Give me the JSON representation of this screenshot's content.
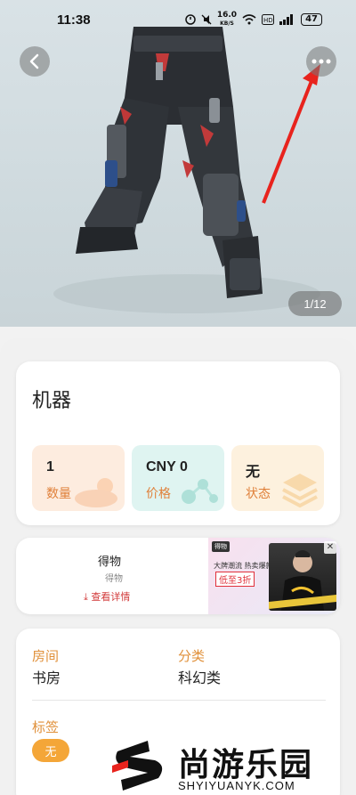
{
  "status_bar": {
    "time": "11:38",
    "net_speed_value": "16.0",
    "net_speed_unit": "KB/S",
    "battery": "47"
  },
  "hero": {
    "page_indicator": "1/12",
    "annotation_color": "#e8231d"
  },
  "item": {
    "title": "机器",
    "stats": [
      {
        "value": "1",
        "label": "数量"
      },
      {
        "value": "CNY 0",
        "label": "价格"
      },
      {
        "value": "无",
        "label": "状态"
      }
    ]
  },
  "ad": {
    "brand": "得物",
    "subtitle": "得物",
    "link": "查看详情",
    "badge": "得物",
    "tagline": "大牌潮流 热卖爆款",
    "promo": "低至3折",
    "close": "✕"
  },
  "info": {
    "room_label": "房间",
    "room_value": "书房",
    "category_label": "分类",
    "category_value": "科幻类",
    "tags_label": "标签",
    "tag_value": "无"
  },
  "watermark": {
    "text": "尚游乐园",
    "url": "SHYIYUANYK.COM"
  },
  "colors": {
    "accent_orange": "#e0903a",
    "link_red": "#d23a3a",
    "chip": "#f4a638"
  }
}
